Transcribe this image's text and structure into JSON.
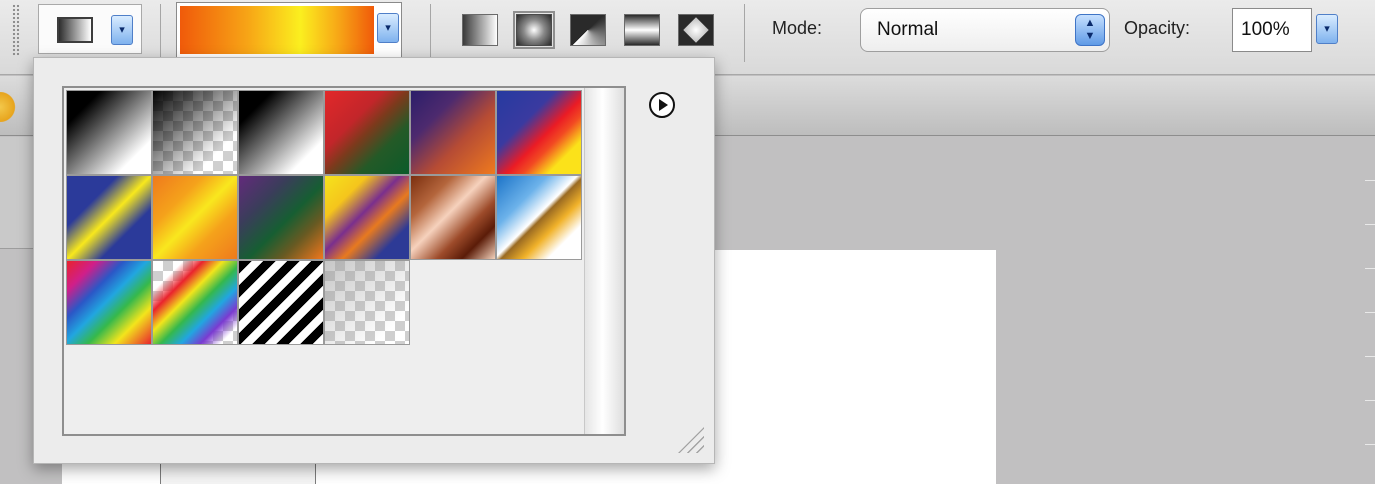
{
  "options_bar": {
    "gradient_preset_dropdown": "▾",
    "gradient_editor_dropdown": "▾",
    "mode_label": "Mode:",
    "mode_value": "Normal",
    "opacity_label": "Opacity:",
    "opacity_value": "100%",
    "opacity_dropdown": "▾",
    "gradient_types": [
      "linear",
      "radial",
      "angle",
      "reflected",
      "diamond"
    ],
    "selected_gradient_type": "radial"
  },
  "presets_popup": {
    "menu_icon": "play-circle-icon",
    "swatches": [
      {
        "name": "Black, White",
        "css": "linear-gradient(135deg,#000 0%,#000 20%,#fff 80%,#fff 100%)"
      },
      {
        "name": "Black to Transparent",
        "css": "linear-gradient(135deg,#000 0%,rgba(0,0,0,0) 75%), repeating-conic-gradient(#cfcfcf 0% 25%, #fff 0% 50%) 0 0/20px 20px"
      },
      {
        "name": "Foreground to Background",
        "css": "linear-gradient(135deg,#000 0%,#000 20%,#fff 80%,#fff 100%)"
      },
      {
        "name": "Red, Green",
        "css": "linear-gradient(135deg,#e2282a 0%,#c2262a 35%,#7b3a1c 50%,#245a27 70%,#0b5b2a 100%)"
      },
      {
        "name": "Violet, Orange",
        "css": "linear-gradient(135deg,#2b1e6a 0%,#4d2a6e 30%,#b54b35 60%,#ef7a1e 100%)"
      },
      {
        "name": "Blue, Red, Yellow",
        "css": "linear-gradient(135deg,#263aa0 0%,#3a3aa0 35%,#ea1b25 55%,#f24a22 65%,#fbe21a 80%,#fbe21a 100%)"
      },
      {
        "name": "Blue, Yellow, Blue",
        "css": "linear-gradient(135deg,#2b3a9a 0%,#2b3a9a 30%,#f8e81c 50%,#2b3a9a 70%,#2b3a9a 100%)"
      },
      {
        "name": "Orange, Yellow, Orange",
        "css": "linear-gradient(135deg,#ef7a1c 0%,#f5a21b 30%,#f9e71e 50%,#f5a21b 70%,#ef7a1c 100%)"
      },
      {
        "name": "Violet, Green, Orange",
        "css": "linear-gradient(135deg,#632a7c 0%,#3a3d5a 30%,#165e32 55%,#6a5a22 75%,#f0771d 100%)"
      },
      {
        "name": "Yellow, Violet, Orange, Blue",
        "css": "linear-gradient(135deg,#f5e31c 0%,#f5c51c 25%,#7a2f8e 45%,#e87a1f 60%,#2d3a96 80%,#2d3a96 100%)"
      },
      {
        "name": "Copper",
        "css": "linear-gradient(135deg,#7b2f0f 0%,#b4653c 25%,#f6d2bd 45%,#9d4b2a 65%,#5b1c08 80%,#f3d2bc 100%)"
      },
      {
        "name": "Chrome",
        "css": "linear-gradient(135deg,#1d74c8 0%,#6cb2ea 30%,#ffffff 48%,#9a6a22 52%,#f1b22a 65%,#ffffff 80%,#ffffff 100%)"
      },
      {
        "name": "Spectrum",
        "css": "linear-gradient(135deg,#e9232d 0%,#cf1f8a 18%,#2b57c6 34%,#21a6e0 48%,#35b84c 62%,#f2e51c 78%,#e9232d 100%)"
      },
      {
        "name": "Transparent Rainbow",
        "css": "linear-gradient(135deg,rgba(255,255,255,0) 0%,rgba(255,255,255,0) 18%,#e9232d 30%,#f2e51c 42%,#35b84c 54%,#21a6e0 66%,#7a3ad0 78%,rgba(255,255,255,0) 90%), repeating-conic-gradient(#cfcfcf 0% 25%, #fff 0% 50%) 0 0/20px 20px"
      },
      {
        "name": "Transparent Stripes",
        "css": "repeating-linear-gradient(135deg,#000 0 9px,#fff 9px 17px) left top/100% 100% no-repeat"
      },
      {
        "name": "Foreground to Transparent",
        "css": "linear-gradient(135deg,rgba(160,160,160,0.6) 0%,rgba(255,255,255,0) 80%), repeating-conic-gradient(#cfcfcf 0% 25%, #fff 0% 50%) 0 0/20px 20px"
      }
    ]
  }
}
